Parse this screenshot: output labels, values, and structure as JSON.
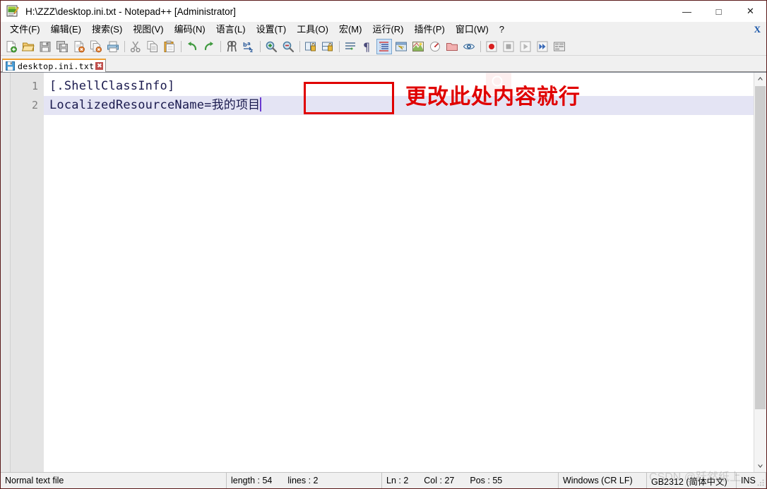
{
  "window": {
    "title": "H:\\ZZZ\\desktop.ini.txt - Notepad++ [Administrator]",
    "icon": "notepad-plus-plus-icon",
    "minimize": "—",
    "maximize": "□",
    "close": "✕"
  },
  "menubar": {
    "items": [
      {
        "label": "文件(F)",
        "name": "menu-file"
      },
      {
        "label": "编辑(E)",
        "name": "menu-edit"
      },
      {
        "label": "搜索(S)",
        "name": "menu-search"
      },
      {
        "label": "视图(V)",
        "name": "menu-view"
      },
      {
        "label": "编码(N)",
        "name": "menu-encoding"
      },
      {
        "label": "语言(L)",
        "name": "menu-language"
      },
      {
        "label": "设置(T)",
        "name": "menu-settings"
      },
      {
        "label": "工具(O)",
        "name": "menu-tools"
      },
      {
        "label": "宏(M)",
        "name": "menu-macro"
      },
      {
        "label": "运行(R)",
        "name": "menu-run"
      },
      {
        "label": "插件(P)",
        "name": "menu-plugins"
      },
      {
        "label": "窗口(W)",
        "name": "menu-window"
      },
      {
        "label": "?",
        "name": "menu-help"
      }
    ],
    "document_close": "X"
  },
  "toolbar": {
    "buttons": [
      "new-file-icon",
      "open-file-icon",
      "save-icon",
      "save-all-icon",
      "close-file-icon",
      "close-all-files-icon",
      "print-icon",
      "cut-icon",
      "copy-icon",
      "paste-icon",
      "undo-icon",
      "redo-icon",
      "find-icon",
      "replace-icon",
      "zoom-in-icon",
      "zoom-out-icon",
      "sync-vertical-scroll-icon",
      "sync-horizontal-scroll-icon",
      "word-wrap-icon",
      "show-all-characters-icon",
      "indent-guide-icon",
      "user-defined-dialog-icon",
      "document-map-icon",
      "function-list-icon",
      "folder-as-workspace-icon",
      "monitoring-icon",
      "macro-record-icon",
      "macro-stop-icon",
      "macro-play-icon",
      "macro-play-multiple-icon",
      "macro-save-icon"
    ]
  },
  "tab": {
    "label": "desktop.ini.txt",
    "icon": "saved-file-icon",
    "close": "✖"
  },
  "editor": {
    "lines": [
      {
        "number": "1",
        "text": "[.ShellClassInfo]",
        "current": false
      },
      {
        "number": "2",
        "text": "LocalizedResourceName=我的项目",
        "current": true
      }
    ],
    "annotation_text": "更改此处内容就行",
    "annotation_color": "#e00000",
    "cursor_after": "我的项目"
  },
  "statusbar": {
    "file_type": "Normal text file",
    "length_label": "length : 54",
    "lines_label": "lines : 2",
    "ln": "Ln : 2",
    "col": "Col : 27",
    "pos": "Pos : 55",
    "eol": "Windows (CR LF)",
    "encoding": "GB2312 (简体中文)",
    "insert_mode": "INS"
  },
  "watermark": {
    "text": "CSDN @跃然纸上"
  }
}
